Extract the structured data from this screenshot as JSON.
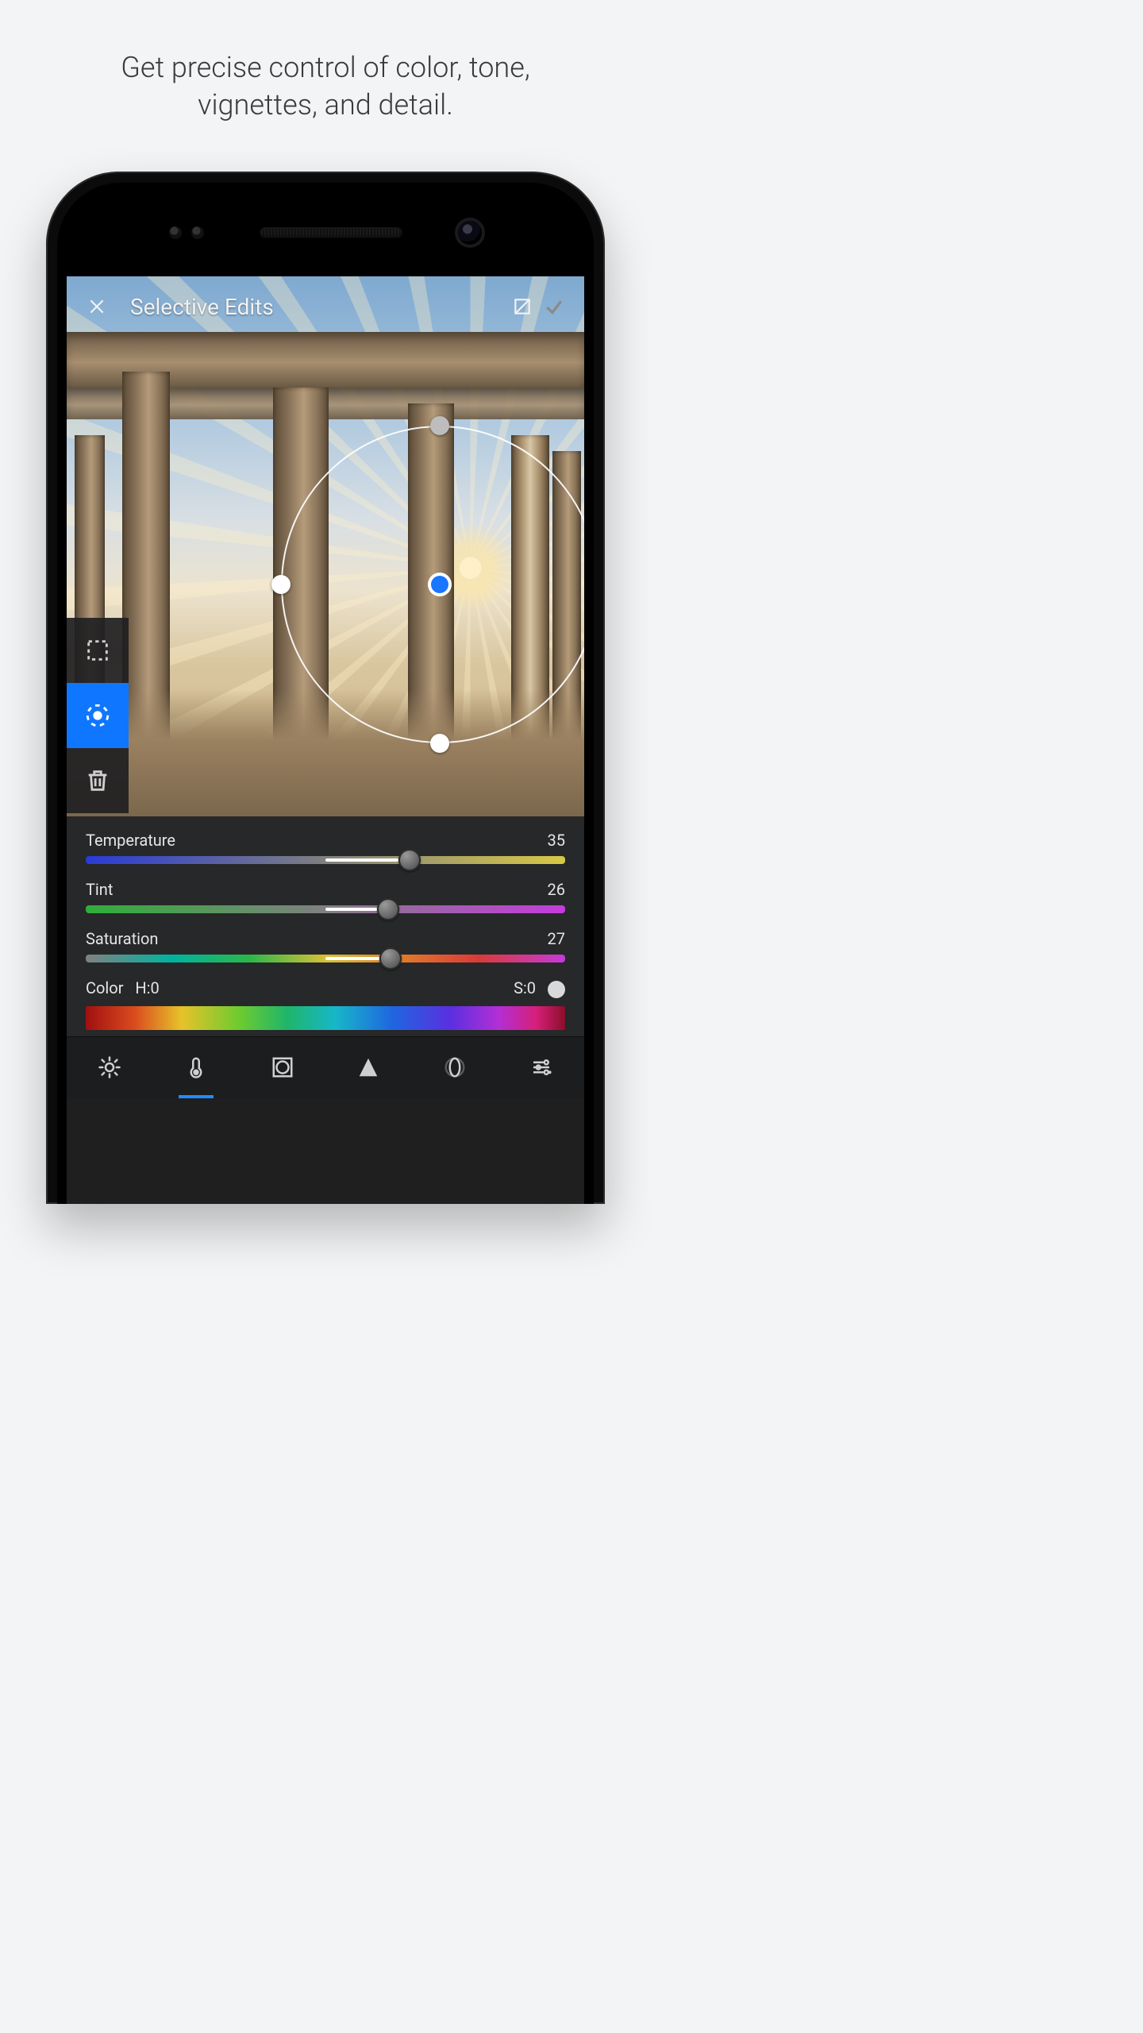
{
  "marketing": {
    "headline_line1": "Get precise control of color, tone,",
    "headline_line2": "vignettes, and detail."
  },
  "appbar": {
    "title": "Selective Edits",
    "close_icon": "close-icon",
    "compare_icon": "compare-box-icon",
    "confirm_icon": "check-icon"
  },
  "toolstrip": {
    "rect_select": "rectangle-select-icon",
    "radial_select": "radial-select-icon",
    "delete": "trash-icon",
    "active_index": 1
  },
  "sliders": {
    "temperature": {
      "label": "Temperature",
      "value": 35,
      "min": -100,
      "max": 100
    },
    "tint": {
      "label": "Tint",
      "value": 26,
      "min": -100,
      "max": 100
    },
    "saturation": {
      "label": "Saturation",
      "value": 27,
      "min": -100,
      "max": 100
    }
  },
  "color_picker": {
    "label": "Color",
    "hue_label": "H:0",
    "sat_label": "S:0"
  },
  "bottombar": {
    "items": [
      {
        "name": "light-icon"
      },
      {
        "name": "color-temp-icon",
        "active": true
      },
      {
        "name": "vignette-icon"
      },
      {
        "name": "detail-icon"
      },
      {
        "name": "lens-icon"
      },
      {
        "name": "adjust-icon"
      }
    ]
  },
  "colors": {
    "accent": "#1f8dff",
    "tool_active": "#0f77ff"
  }
}
